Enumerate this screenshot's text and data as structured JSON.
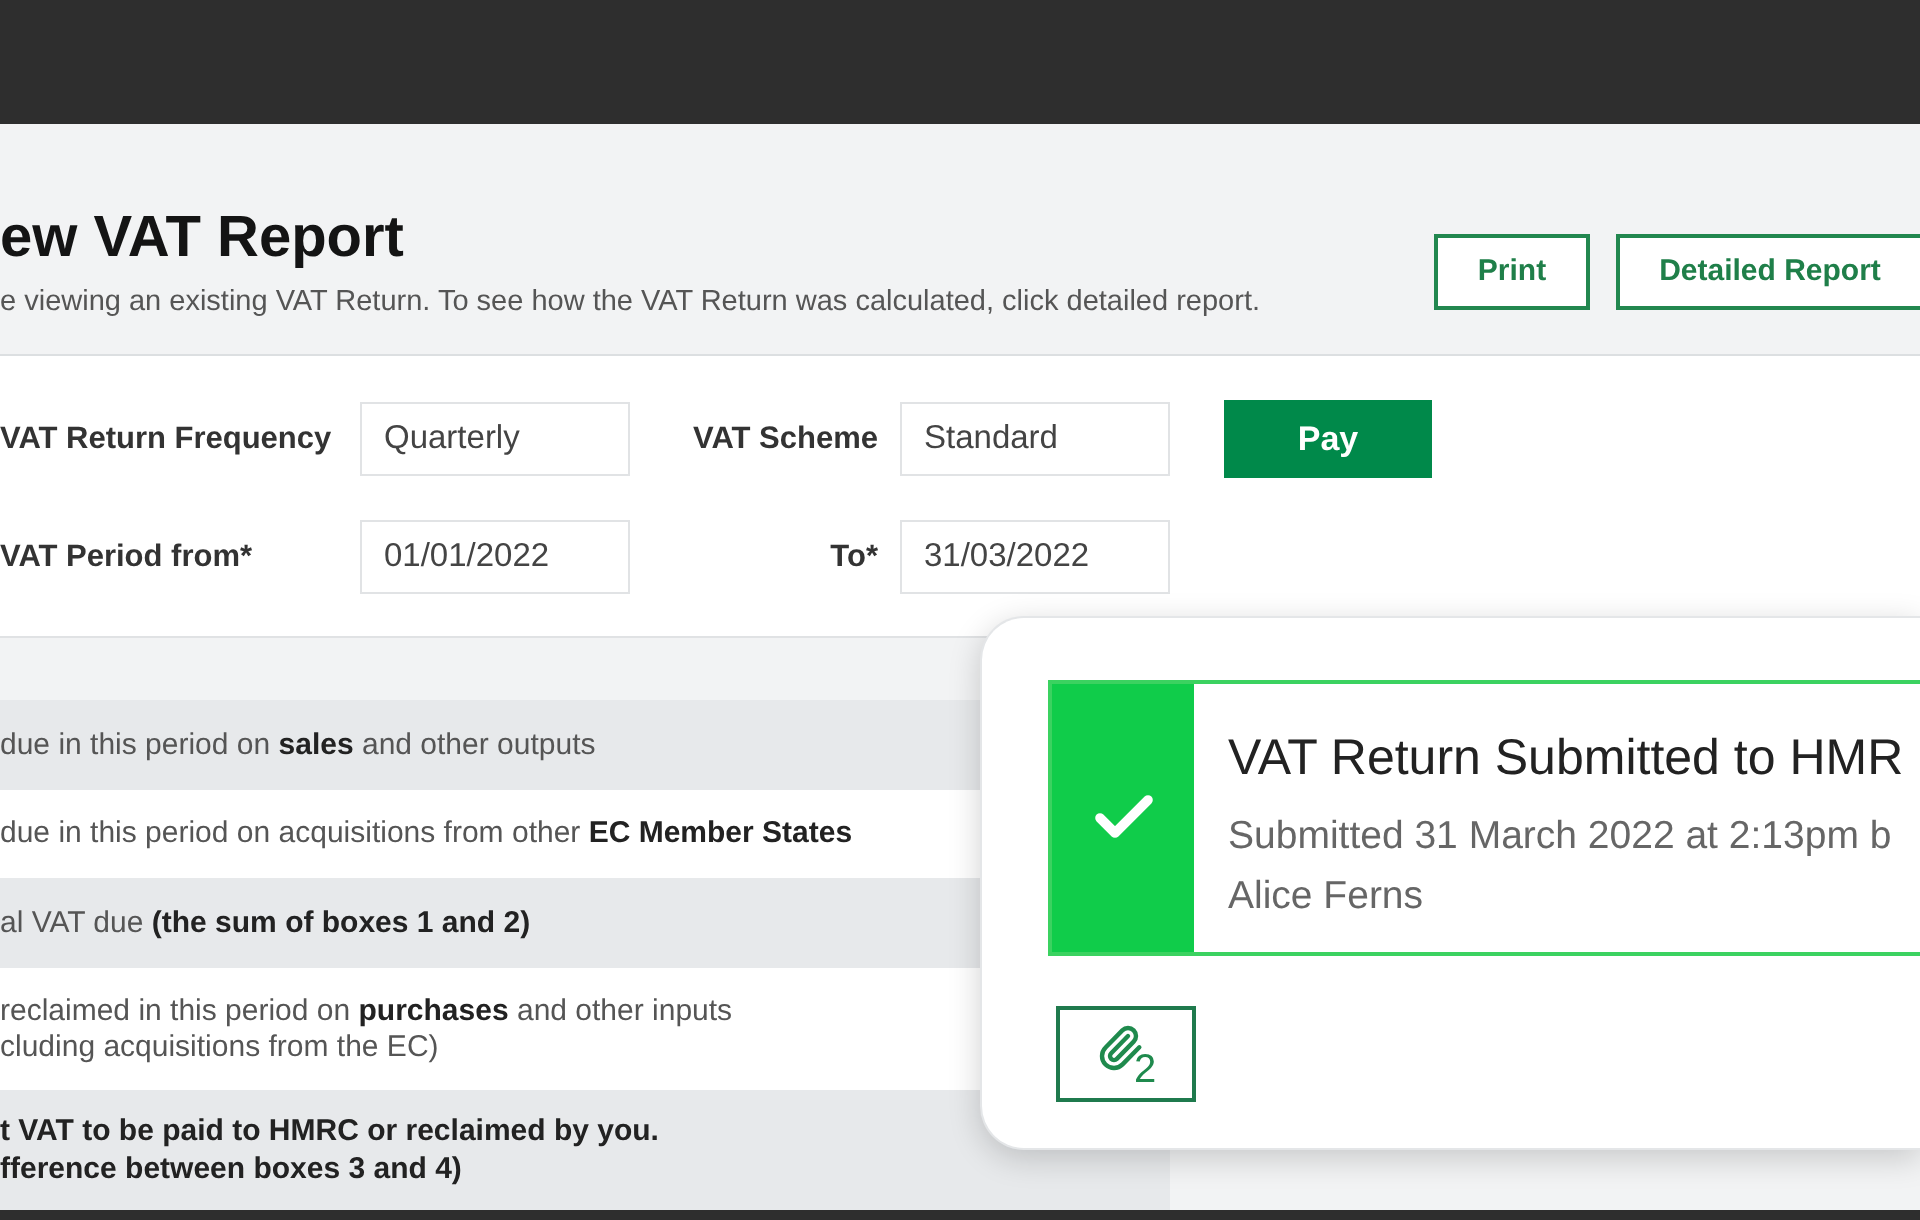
{
  "header": {
    "title": "ew VAT Report",
    "subtitle": "e viewing an existing VAT Return. To see how the VAT Return was calculated, click detailed report.",
    "buttons": [
      {
        "label": "Print"
      },
      {
        "label": "Detailed Report"
      }
    ]
  },
  "form": {
    "rows": [
      {
        "fields": [
          {
            "label": "VAT Return Frequency",
            "value": "Quarterly"
          },
          {
            "label": "VAT Scheme",
            "value": "Standard"
          }
        ],
        "action": {
          "label": "Pay"
        }
      },
      {
        "fields": [
          {
            "label": "VAT Period from*",
            "value": "01/01/2022"
          },
          {
            "label": "To*",
            "value": "31/03/2022"
          }
        ]
      }
    ]
  },
  "table": {
    "rows": [
      {
        "kind": "line",
        "lines": [
          "due in this period on **sales** and other outputs"
        ]
      },
      {
        "kind": "line",
        "lines": [
          "due in this period on acquisitions from other **EC Member States**"
        ]
      },
      {
        "kind": "line",
        "lines": [
          "al VAT due **(the sum of boxes 1 and 2)**"
        ]
      },
      {
        "kind": "line",
        "lines": [
          "reclaimed in this period on **purchases** and other inputs",
          "cluding acquisitions from the EC)"
        ]
      },
      {
        "kind": "total",
        "lines": [
          "t VAT to be paid to HMRC or reclaimed by you.",
          "fference between boxes 3 and 4)"
        ]
      }
    ]
  },
  "notification": {
    "kind": "success",
    "title": "VAT Return Submitted to HMR",
    "detail_lines": [
      "Submitted 31 March 2022 at 2:13pm b",
      "Alice Ferns"
    ],
    "attachments_button": {
      "count": "2"
    }
  }
}
